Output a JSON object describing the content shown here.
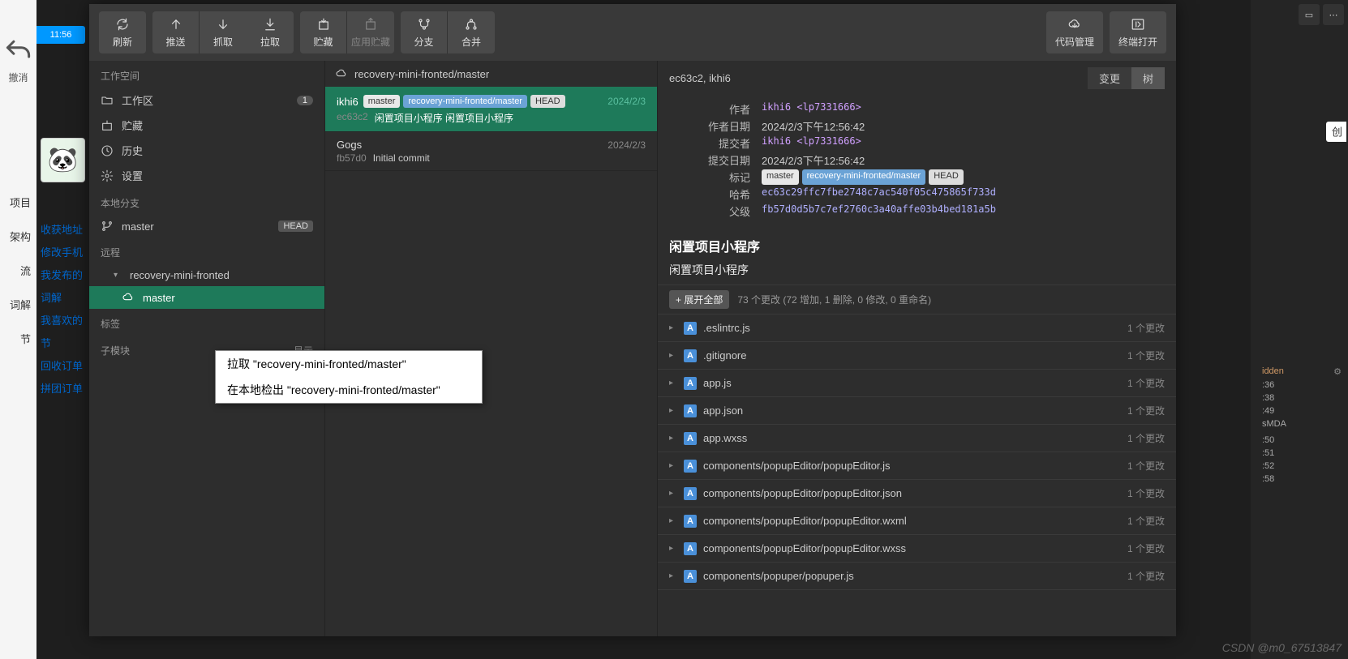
{
  "bg": {
    "undo_label": "撤消",
    "time": "11:56",
    "links": [
      "收获地址",
      "修改手机",
      "我发布的",
      "词解",
      "我喜欢的",
      "节",
      "回收订单",
      "拼团订单"
    ],
    "left_edge": [
      "项目",
      "架构流",
      "词解",
      "节"
    ],
    "create": "创",
    "dev_rows": [
      {
        "t": "idden",
        "r": "⚙"
      },
      {
        "t": ":36",
        "r": ""
      },
      {
        "t": ":38",
        "r": ""
      },
      {
        "t": ":49",
        "r": ""
      },
      {
        "t": "sMDA",
        "r": ""
      },
      {
        "t": "",
        "r": ""
      },
      {
        "t": ":50",
        "r": ""
      },
      {
        "t": ":51",
        "r": ""
      },
      {
        "t": ":52",
        "r": ""
      },
      {
        "t": ":58",
        "r": ""
      }
    ]
  },
  "toolbar": {
    "refresh": "刷新",
    "push": "推送",
    "fetch": "抓取",
    "pull": "拉取",
    "stash": "贮藏",
    "applystash": "应用贮藏",
    "branch": "分支",
    "merge": "合并",
    "repo": "代码管理",
    "terminal": "终端打开"
  },
  "sidebar": {
    "workspace_sec": "工作空间",
    "workarea": "工作区",
    "workarea_badge": "1",
    "stash": "贮藏",
    "history": "历史",
    "settings": "设置",
    "local_sec": "本地分支",
    "local_master": "master",
    "head_badge": "HEAD",
    "remote_sec": "远程",
    "remote_name": "recovery-mini-fronted",
    "remote_master": "master",
    "tags_sec": "标签",
    "submod_sec": "子模块",
    "show": "显示"
  },
  "commits": {
    "header": "recovery-mini-fronted/master",
    "list": [
      {
        "author": "ikhi6",
        "date": "2024/2/3",
        "tags": [
          {
            "t": "master",
            "c": "local"
          },
          {
            "t": "recovery-mini-fronted/master",
            "c": "remote"
          },
          {
            "t": "HEAD",
            "c": "head"
          }
        ],
        "hash": "ec63c2",
        "msg": "闲置项目小程序 闲置项目小程序",
        "sel": true
      },
      {
        "author": "Gogs",
        "date": "2024/2/3",
        "tags": [],
        "hash": "fb57d0",
        "msg": "Initial commit",
        "sel": false
      }
    ]
  },
  "detail": {
    "header": "ec63c2, ikhi6",
    "tab_changes": "变更",
    "tab_tree": "树",
    "meta": {
      "author_lbl": "作者",
      "author": "ikhi6 <lp7331666>",
      "authordate_lbl": "作者日期",
      "authordate": "2024/2/3下午12:56:42",
      "committer_lbl": "提交者",
      "committer": "ikhi6 <lp7331666>",
      "commitdate_lbl": "提交日期",
      "commitdate": "2024/2/3下午12:56:42",
      "tags_lbl": "标记",
      "hash_lbl": "哈希",
      "hash": "ec63c29ffc7fbe2748c7ac540f05c475865f733d",
      "parent_lbl": "父级",
      "parent": "fb57d0d5b7c7ef2760c3a40affe03b4bed181a5b"
    },
    "title": "闲置项目小程序",
    "subtitle": "闲置项目小程序",
    "expand": "+ 展开全部",
    "stats": "73 个更改 (72 增加, 1 删除, 0 修改, 0 重命名)",
    "files": [
      {
        "name": ".eslintrc.js",
        "chg": "1 个更改"
      },
      {
        "name": ".gitignore",
        "chg": "1 个更改"
      },
      {
        "name": "app.js",
        "chg": "1 个更改"
      },
      {
        "name": "app.json",
        "chg": "1 个更改"
      },
      {
        "name": "app.wxss",
        "chg": "1 个更改"
      },
      {
        "name": "components/popupEditor/popupEditor.js",
        "chg": "1 个更改"
      },
      {
        "name": "components/popupEditor/popupEditor.json",
        "chg": "1 个更改"
      },
      {
        "name": "components/popupEditor/popupEditor.wxml",
        "chg": "1 个更改"
      },
      {
        "name": "components/popupEditor/popupEditor.wxss",
        "chg": "1 个更改"
      },
      {
        "name": "components/popuper/popuper.js",
        "chg": "1 个更改"
      }
    ]
  },
  "ctx": {
    "item1": "拉取 \"recovery-mini-fronted/master\"",
    "item2": "在本地检出 \"recovery-mini-fronted/master\""
  },
  "watermark": "CSDN @m0_67513847"
}
